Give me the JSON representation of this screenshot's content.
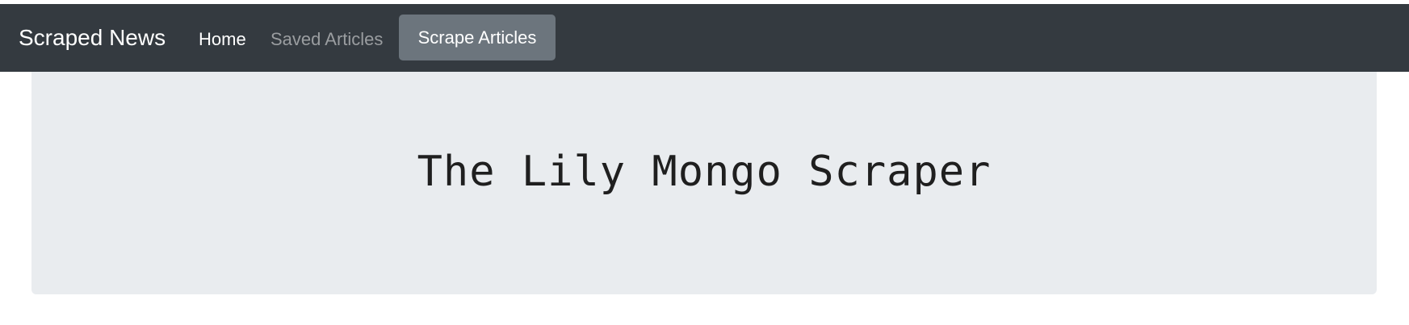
{
  "navbar": {
    "brand": "Scraped News",
    "links": [
      {
        "label": "Home",
        "active": true
      },
      {
        "label": "Saved Articles",
        "active": false
      }
    ],
    "scrape_button_label": "Scrape Articles"
  },
  "jumbotron": {
    "title": "The Lily Mongo Scraper"
  },
  "colors": {
    "navbar_bg": "#343a40",
    "button_bg": "#6c757d",
    "jumbotron_bg": "#e9ecef"
  }
}
